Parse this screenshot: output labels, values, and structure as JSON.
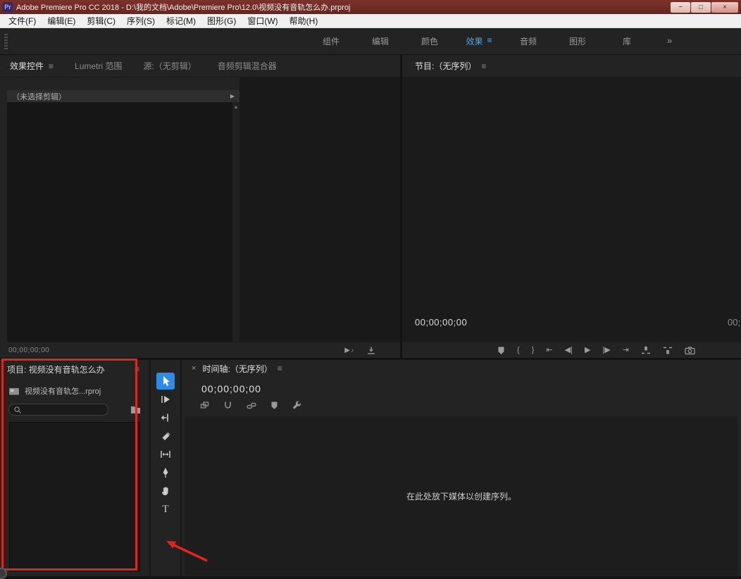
{
  "colors": {
    "titlebar_bg": "#6e2823",
    "accent_blue": "#3da9ff",
    "active_tool_bg": "#2d8ceb",
    "annotation_red": "#e1251b"
  },
  "titlebar": {
    "app_icon": "Pr",
    "title": "Adobe Premiere Pro CC 2018 - D:\\我的文档\\Adobe\\Premiere Pro\\12.0\\视频没有音轨怎么办.prproj",
    "minimize": "−",
    "maximize": "□",
    "close": "×"
  },
  "menubar": {
    "items": [
      {
        "label": "文件(F)"
      },
      {
        "label": "编辑(E)"
      },
      {
        "label": "剪辑(C)"
      },
      {
        "label": "序列(S)"
      },
      {
        "label": "标记(M)"
      },
      {
        "label": "图形(G)"
      },
      {
        "label": "窗口(W)"
      },
      {
        "label": "帮助(H)"
      }
    ]
  },
  "workspace": {
    "tabs": [
      {
        "label": "组件",
        "active": false
      },
      {
        "label": "编辑",
        "active": false
      },
      {
        "label": "颜色",
        "active": false
      },
      {
        "label": "效果",
        "active": true
      },
      {
        "label": "音频",
        "active": false
      },
      {
        "label": "图形",
        "active": false
      },
      {
        "label": "库",
        "active": false
      }
    ],
    "active_menu_glyph": "≡",
    "overflow": "»"
  },
  "effect_controls": {
    "tabs": [
      {
        "label": "效果控件",
        "active": true
      },
      {
        "label": "Lumetri 范围",
        "active": false
      },
      {
        "label": "源:（无剪辑）",
        "active": false
      },
      {
        "label": "音频剪辑混合器",
        "active": false
      }
    ],
    "menu_glyph": "≡",
    "clip_status": "（未选择剪辑）",
    "expand_glyph": "▶",
    "scroll_up_glyph": "▲",
    "timecode": "00;00;00;00",
    "bottom_icons": [
      "play-audio",
      "export"
    ],
    "play_audio_glyph": "▶",
    "play_audio_note": "♪"
  },
  "program_monitor": {
    "title": "节目:（无序列）",
    "menu_glyph": "≡",
    "timecode": "00;00;00;00",
    "timecode_right": "00;",
    "transport_icons": [
      "add-marker",
      "mark-in",
      "mark-out",
      "go-to-in",
      "step-back",
      "play",
      "step-forward",
      "go-to-out",
      "lift",
      "extract",
      "export-frame"
    ],
    "transport": {
      "mark_in": "{",
      "mark_out": "}",
      "go_to_in": "⇤",
      "step_back": "◀|",
      "play": "▶",
      "step_forward": "|▶",
      "go_to_out": "⇥"
    }
  },
  "project_panel": {
    "title": "项目: 视频没有音轨怎么办",
    "menu_glyph": "≡",
    "item_label": "视频没有音轨怎...rproj",
    "search_value": ""
  },
  "tools": {
    "active": "selection-tool",
    "items": [
      "selection-tool",
      "track-select-forward-tool",
      "ripple-edit-tool",
      "razor-tool",
      "slip-tool",
      "pen-tool",
      "hand-tool",
      "type-tool"
    ],
    "type_tool_glyph": "T"
  },
  "timeline": {
    "close_glyph": "×",
    "title": "时间轴:（无序列）",
    "menu_glyph": "≡",
    "timecode": "00;00;00;00",
    "toolbar_icons": [
      "nest",
      "snap",
      "linked-selection",
      "add-marker",
      "timeline-settings"
    ],
    "drop_message": "在此处放下媒体以创建序列。"
  }
}
